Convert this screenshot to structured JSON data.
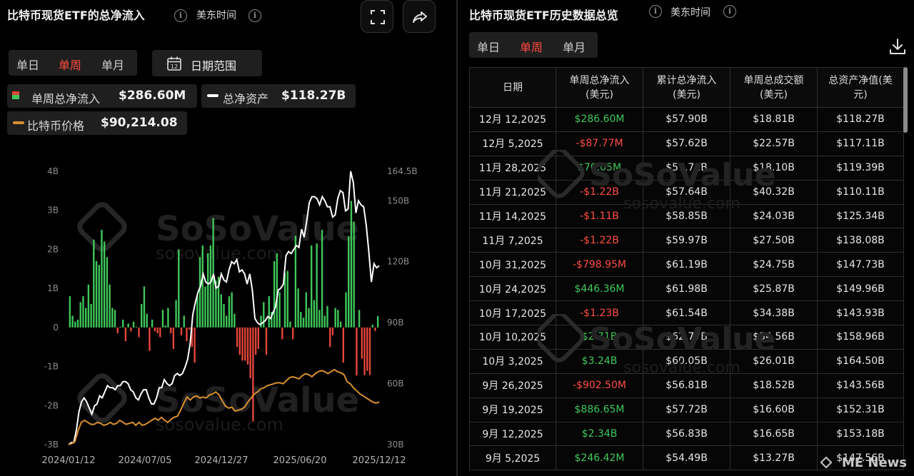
{
  "left_panel": {
    "title": "比特币现货ETF的总净流入",
    "timezone": "美东时间",
    "tabs": [
      "单日",
      "单周",
      "单月"
    ],
    "active_tab": "单周",
    "date_range_label": "日期范围",
    "calendar_number": "12",
    "legend": {
      "inflow_label": "单周总净流入",
      "inflow_value": "$286.60M",
      "assets_label": "总净资产",
      "assets_value": "$118.27B",
      "price_label": "比特币价格",
      "price_value": "$90,214.08"
    },
    "watermark": "SoSoValue",
    "watermark_url": "sosovalue.com"
  },
  "right_panel": {
    "title": "比特币现货ETF历史数据总览",
    "timezone": "美东时间",
    "tabs": [
      "单日",
      "单周",
      "单月"
    ],
    "active_tab": "单周",
    "columns": [
      "日期",
      "单周总净流入(美元)",
      "累计总净流入(美元)",
      "单周总成交额(美元)",
      "总资产净值(美元)"
    ],
    "rows": [
      {
        "date": "12月 12,2025",
        "flow": "$286.60M",
        "cum": "$57.90B",
        "vol": "$18.81B",
        "nav": "$118.27B",
        "sign": "pos"
      },
      {
        "date": "12月 5,2025",
        "flow": "-$87.77M",
        "cum": "$57.62B",
        "vol": "$22.57B",
        "nav": "$117.11B",
        "sign": "neg"
      },
      {
        "date": "11月 28,2025",
        "flow": "$70.05M",
        "cum": "$57.71B",
        "vol": "$18.10B",
        "nav": "$119.39B",
        "sign": "pos"
      },
      {
        "date": "11月 21,2025",
        "flow": "-$1.22B",
        "cum": "$57.64B",
        "vol": "$40.32B",
        "nav": "$110.11B",
        "sign": "neg"
      },
      {
        "date": "11月 14,2025",
        "flow": "-$1.11B",
        "cum": "$58.85B",
        "vol": "$24.03B",
        "nav": "$125.34B",
        "sign": "neg"
      },
      {
        "date": "11月 7,2025",
        "flow": "-$1.22B",
        "cum": "$59.97B",
        "vol": "$27.50B",
        "nav": "$138.08B",
        "sign": "neg"
      },
      {
        "date": "10月 31,2025",
        "flow": "-$798.95M",
        "cum": "$61.19B",
        "vol": "$24.75B",
        "nav": "$147.73B",
        "sign": "neg"
      },
      {
        "date": "10月 24,2025",
        "flow": "$446.36M",
        "cum": "$61.98B",
        "vol": "$25.87B",
        "nav": "$149.96B",
        "sign": "pos"
      },
      {
        "date": "10月 17,2025",
        "flow": "-$1.23B",
        "cum": "$61.54B",
        "vol": "$34.38B",
        "nav": "$143.93B",
        "sign": "neg"
      },
      {
        "date": "10月 10,2025",
        "flow": "$2.71B",
        "cum": "$62.77B",
        "vol": "$34.56B",
        "nav": "$158.96B",
        "sign": "pos"
      },
      {
        "date": "10月 3,2025",
        "flow": "$3.24B",
        "cum": "$60.05B",
        "vol": "$26.01B",
        "nav": "$164.50B",
        "sign": "pos"
      },
      {
        "date": "9月 26,2025",
        "flow": "-$902.50M",
        "cum": "$56.81B",
        "vol": "$18.52B",
        "nav": "$143.56B",
        "sign": "neg"
      },
      {
        "date": "9月 19,2025",
        "flow": "$886.65M",
        "cum": "$57.72B",
        "vol": "$16.60B",
        "nav": "$152.31B",
        "sign": "pos"
      },
      {
        "date": "9月 12,2025",
        "flow": "$2.34B",
        "cum": "$56.83B",
        "vol": "$16.65B",
        "nav": "$153.18B",
        "sign": "pos"
      },
      {
        "date": "9月 5,2025",
        "flow": "$246.42M",
        "cum": "$54.49B",
        "vol": "$13.27B",
        "nav": "$147.56B",
        "sign": "pos"
      }
    ],
    "watermark": "SoSoValue",
    "watermark_url": "sosovalue.com",
    "news_watermark": "ME News"
  },
  "colors": {
    "positive": "#3fc85a",
    "negative": "#e5453a",
    "assets_line": "#ffffff",
    "price_line": "#d9902f",
    "active_tab": "#ff4a3d"
  },
  "icons": [
    "info-icon",
    "fullscreen-icon",
    "share-icon",
    "calendar-icon",
    "download-icon"
  ],
  "chart_data": {
    "type": "bar",
    "title": "比特币现货ETF的总净流入",
    "y_left_ticks": [
      "4B",
      "3B",
      "2B",
      "1B",
      "0",
      "-1B",
      "-2B",
      "-3B"
    ],
    "y_left_range": [
      -3,
      4
    ],
    "y_right_ticks": [
      "164.5B",
      "150B",
      "120B",
      "90B",
      "60B",
      "30B"
    ],
    "y_right_range": [
      30,
      164.5
    ],
    "x_ticks": [
      "2024/01/12",
      "2024/07/05",
      "2024/12/27",
      "2025/06/20",
      "2025/12/12"
    ],
    "series": [
      {
        "name": "单周总净流入",
        "unit": "B",
        "type": "bar",
        "values": [
          0.8,
          0.3,
          0.15,
          0.2,
          0.65,
          0.8,
          0.5,
          1.1,
          0.6,
          2.25,
          1.7,
          1.6,
          2.5,
          2.2,
          1.8,
          1.1,
          0.5,
          0.45,
          -0.15,
          0.02,
          0.2,
          -0.35,
          0.1,
          -0.1,
          0.15,
          0.02,
          -0.25,
          0.6,
          1.05,
          0.35,
          -0.6,
          0.2,
          -0.1,
          -0.15,
          -0.25,
          0.45,
          0.05,
          0.5,
          -0.15,
          -0.55,
          0.7,
          2.0,
          -0.2,
          0.3,
          -0.35,
          -0.05,
          -0.5,
          -0.9,
          0.8,
          1.8,
          2.1,
          1.05,
          1.9,
          2.1,
          2.8,
          1.2,
          1.3,
          0.85,
          0.6,
          0.3,
          0.8,
          0.9,
          0.35,
          -0.5,
          -0.7,
          -0.85,
          -0.85,
          -0.95,
          -1.3,
          -2.4,
          -0.7,
          -0.55,
          0.3,
          0.65,
          -0.7,
          0.8,
          0.4,
          1.7,
          1.9,
          0.9,
          -0.3,
          1.4,
          1.45,
          0.15,
          -0.3,
          2.35,
          1.0,
          0.4,
          0.25,
          0.9,
          0.5,
          2.1,
          0.7,
          2.15,
          0.45,
          2.5,
          0.3,
          0.55,
          -0.5,
          -0.2,
          0.5,
          0.45,
          0.15,
          -0.9,
          0.9,
          2.34,
          3.24,
          2.71,
          -1.23,
          0.45,
          -0.8,
          -1.22,
          -1.11,
          -1.22,
          0.07,
          -0.09,
          0.29
        ]
      },
      {
        "name": "总净资产",
        "unit": "B",
        "type": "line",
        "values": [
          30,
          31,
          31,
          37,
          46,
          51,
          53,
          51,
          48,
          45,
          49,
          50,
          54,
          53,
          56,
          59,
          58,
          58,
          57,
          59,
          59,
          61,
          61,
          60,
          57,
          56,
          53,
          52,
          55,
          57,
          57,
          53,
          50,
          50,
          53,
          58,
          58,
          62,
          60,
          59,
          60,
          64,
          65,
          64,
          65,
          68,
          72,
          80,
          94,
          100,
          105,
          108,
          114,
          110,
          109,
          110,
          114,
          107,
          108,
          114,
          111,
          110,
          116,
          120,
          119,
          121,
          115,
          116,
          114,
          109,
          114,
          106,
          92,
          90,
          89,
          90,
          91,
          93,
          92,
          95,
          98,
          106,
          107,
          109,
          123,
          125,
          124,
          126,
          128,
          127,
          136,
          132,
          140,
          149,
          152,
          152,
          151,
          148,
          152,
          150,
          147,
          147,
          142,
          143,
          151,
          155,
          154,
          145,
          146,
          164.5,
          159,
          144,
          150,
          148,
          147,
          138,
          125,
          110,
          119,
          117,
          118
        ]
      },
      {
        "name": "比特币价格",
        "type": "line",
        "values_relative": [
          0.0,
          0.01,
          0.03,
          0.14,
          0.22,
          0.24,
          0.22,
          0.2,
          0.2,
          0.22,
          0.21,
          0.19,
          0.2,
          0.22,
          0.2,
          0.21,
          0.24,
          0.22,
          0.2,
          0.21,
          0.22,
          0.19,
          0.22,
          0.19,
          0.2,
          0.22,
          0.24,
          0.26,
          0.24,
          0.27,
          0.24,
          0.22,
          0.25,
          0.27,
          0.28,
          0.34,
          0.41,
          0.47,
          0.44,
          0.47,
          0.48,
          0.46,
          0.47,
          0.46,
          0.49,
          0.5,
          0.52,
          0.49,
          0.43,
          0.38,
          0.36,
          0.37,
          0.33,
          0.34,
          0.35,
          0.37,
          0.42,
          0.46,
          0.5,
          0.52,
          0.55,
          0.56,
          0.58,
          0.59,
          0.6,
          0.61,
          0.61,
          0.6,
          0.63,
          0.66,
          0.67,
          0.66,
          0.65,
          0.68,
          0.7,
          0.69,
          0.67,
          0.7,
          0.72,
          0.73,
          0.72,
          0.7,
          0.72,
          0.74,
          0.72,
          0.71,
          0.69,
          0.62,
          0.6,
          0.56,
          0.53,
          0.5,
          0.48,
          0.46,
          0.44,
          0.42,
          0.41,
          0.42
        ]
      }
    ],
    "legend": [
      "单周总净流入",
      "总净资产",
      "比特币价格"
    ],
    "grid": false
  }
}
